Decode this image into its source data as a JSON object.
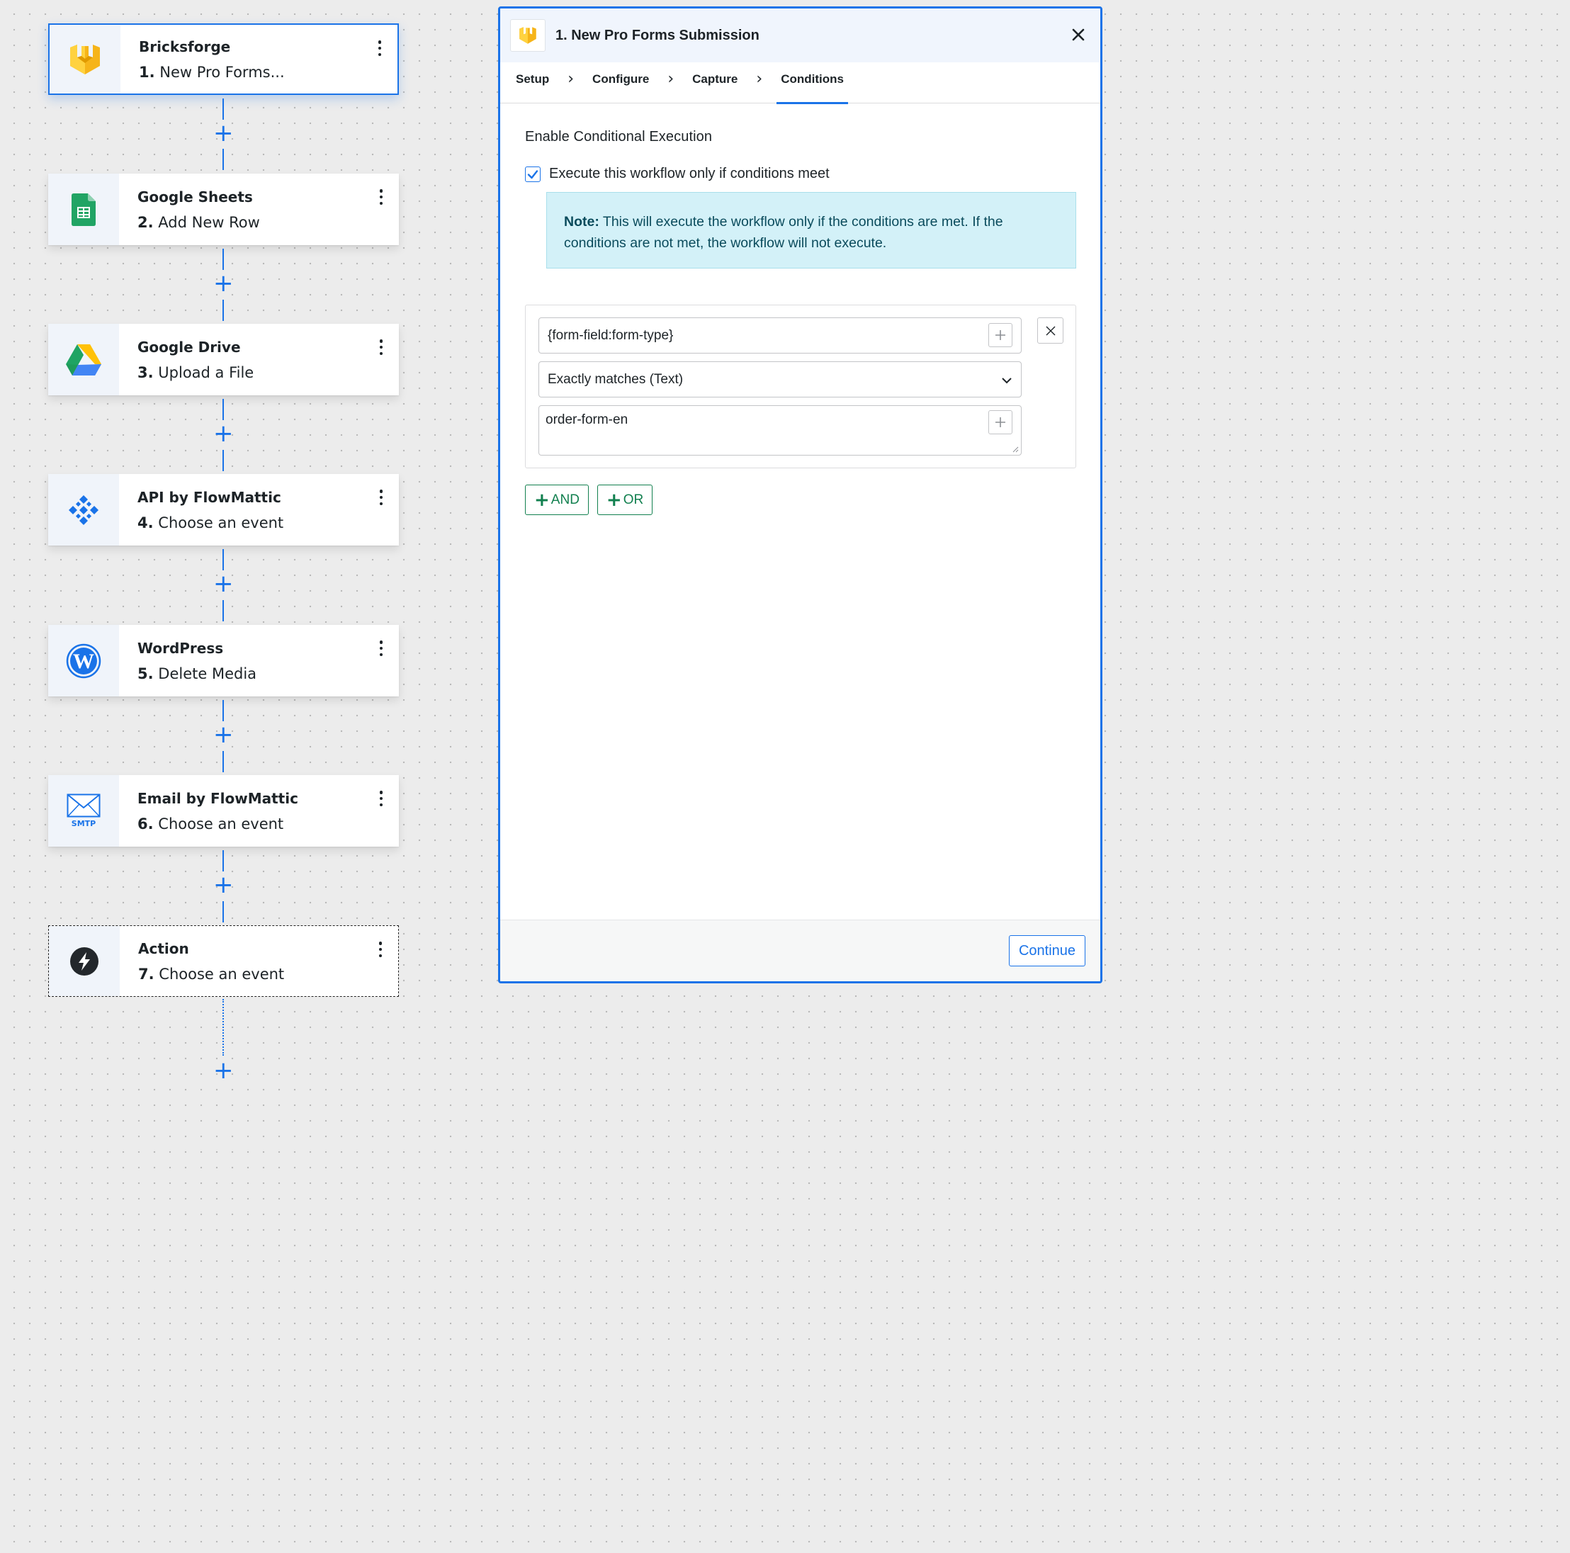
{
  "workflow": {
    "steps": [
      {
        "app": "Bricksforge",
        "number": "1.",
        "event": "New Pro Forms...",
        "icon": "bricksforge-icon"
      },
      {
        "app": "Google Sheets",
        "number": "2.",
        "event": "Add New Row",
        "icon": "google-sheets-icon"
      },
      {
        "app": "Google Drive",
        "number": "3.",
        "event": "Upload a File",
        "icon": "google-drive-icon"
      },
      {
        "app": "API by FlowMattic",
        "number": "4.",
        "event": "Choose an event",
        "icon": "api-icon"
      },
      {
        "app": "WordPress",
        "number": "5.",
        "event": "Delete Media",
        "icon": "wordpress-icon"
      },
      {
        "app": "Email by FlowMattic",
        "number": "6.",
        "event": "Choose an event",
        "icon": "email-smtp-icon",
        "icon_label": "SMTP"
      },
      {
        "app": "Action",
        "number": "7.",
        "event": "Choose an event",
        "icon": "lightning-icon"
      }
    ],
    "add_step_symbol": "+"
  },
  "panel": {
    "title": "1. New Pro Forms Submission",
    "tabs": [
      "Setup",
      "Configure",
      "Capture",
      "Conditions"
    ],
    "active_tab": "Conditions",
    "section_title": "Enable Conditional Execution",
    "checkbox_label": "Execute this workflow only if conditions meet",
    "checkbox_checked": true,
    "note_label": "Note:",
    "note_text": "This will execute the workflow only if the conditions are met. If the conditions are not met, the workflow will not execute.",
    "condition": {
      "field": "{form-field:form-type}",
      "operator": "Exactly matches (Text)",
      "value": "order-form-en"
    },
    "and_label": "AND",
    "or_label": "OR",
    "continue_label": "Continue"
  },
  "colors": {
    "accent": "#1a73e8",
    "success": "#12804f",
    "note_bg": "#d3f1f8",
    "canvas_bg": "#ececec"
  }
}
